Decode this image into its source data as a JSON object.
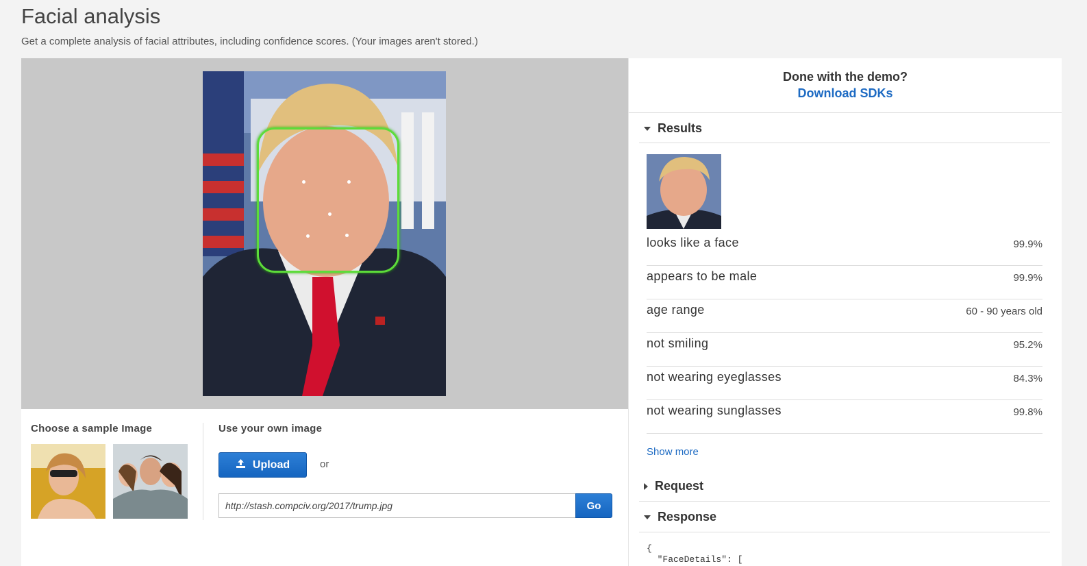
{
  "page": {
    "title": "Facial analysis",
    "subtitle": "Get a complete analysis of facial attributes, including confidence scores. (Your images aren't stored.)"
  },
  "samples": {
    "heading": "Choose a sample Image"
  },
  "own_image": {
    "heading": "Use your own image",
    "upload_label": "Upload",
    "or_text": "or",
    "url_value": "http://stash.compciv.org/2017/trump.jpg",
    "go_label": "Go"
  },
  "sidebar": {
    "done_text": "Done with the demo?",
    "sdk_link": "Download SDKs",
    "results_header": "Results",
    "results": [
      {
        "label": "looks like a face",
        "value": "99.9%"
      },
      {
        "label": "appears to be male",
        "value": "99.9%"
      },
      {
        "label": "age range",
        "value": "60 - 90 years old"
      },
      {
        "label": "not smiling",
        "value": "95.2%"
      },
      {
        "label": "not wearing eyeglasses",
        "value": "84.3%"
      },
      {
        "label": "not wearing sunglasses",
        "value": "99.8%"
      }
    ],
    "show_more": "Show more",
    "request_header": "Request",
    "response_header": "Response",
    "response_lines": [
      "{",
      "  \"FaceDetails\": ["
    ]
  },
  "colors": {
    "accent": "#1e6bc3",
    "button": "#1565c0",
    "face_box": "#5ddc3a",
    "stage": "#c8c8c8"
  },
  "icons": {
    "upload": "upload-icon",
    "caret_open": "caret-down-icon",
    "caret_closed": "caret-right-icon"
  }
}
